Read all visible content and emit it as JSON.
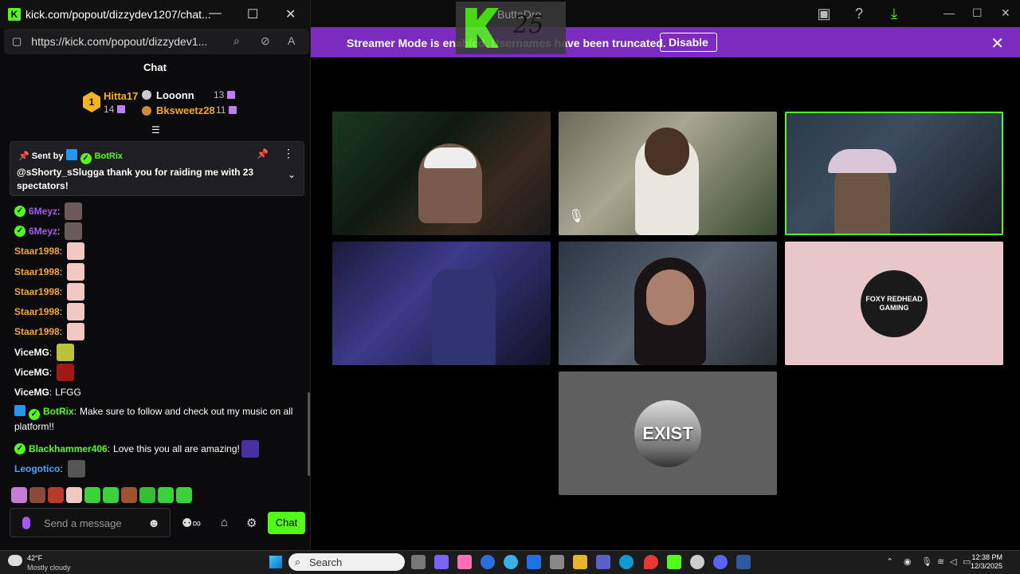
{
  "chat_window": {
    "title": "kick.com/popout/dizzydev1207/chat...",
    "url": "https://kick.com/popout/dizzydev1...",
    "header": "Chat"
  },
  "leaderboard": {
    "rank1_name": "Hitta17",
    "rank1_count": "14",
    "rank2_name": "Looonn",
    "rank2_count": "13",
    "rank3_name": "Bksweetz28",
    "rank3_count": "11"
  },
  "pinned": {
    "sent_by_label": "Sent by",
    "sender": "BotRix",
    "message": "@sShorty_sSlugga thank you for raiding me with 23 spectators!"
  },
  "messages": [
    {
      "user": "6Meyz",
      "color": "#a855f7",
      "text": ""
    },
    {
      "user": "6Meyz",
      "color": "#a855f7",
      "text": ""
    },
    {
      "user": "Staar1998",
      "color": "#f5a623",
      "text": ""
    },
    {
      "user": "Staar1998",
      "color": "#f5a623",
      "text": ""
    },
    {
      "user": "Staar1998",
      "color": "#f5a623",
      "text": ""
    },
    {
      "user": "Staar1998",
      "color": "#f5a623",
      "text": ""
    },
    {
      "user": "Staar1998",
      "color": "#f5a623",
      "text": ""
    },
    {
      "user": "ViceMG",
      "color": "#ffffff",
      "text": ""
    },
    {
      "user": "ViceMG",
      "color": "#ffffff",
      "text": ""
    },
    {
      "user": "ViceMG",
      "color": "#ffffff",
      "text": "LFGG"
    }
  ],
  "botrix_msg": {
    "user": "BotRix",
    "text": "Make sure to follow and check out my music on all platform!!"
  },
  "blackhammer_msg": {
    "user": "Blackhammer406",
    "text": "Love this you all are amazing!"
  },
  "leogotico_msg": {
    "user": "Leogotico"
  },
  "input": {
    "placeholder": "Send a message",
    "send_label": "Chat"
  },
  "banner": {
    "text": "Streamer Mode is enabled. Usernames have been truncated.",
    "button": "Disable"
  },
  "app_title_number": "25",
  "app_title_text": "ButtaDro",
  "tiles": [
    {
      "name": "tile-1",
      "bg": "#1d2a1d"
    },
    {
      "name": "tile-2",
      "bg": "#5a5a4a"
    },
    {
      "name": "tile-3",
      "bg": "#2a3442"
    },
    {
      "name": "tile-4",
      "bg": "#1e1e3a"
    },
    {
      "name": "tile-5",
      "bg": "#3b3f4a"
    },
    {
      "name": "tile-6",
      "bg": "#e7c7c9"
    },
    {
      "name": "tile-7",
      "bg": "#5f5f5f"
    }
  ],
  "foxy_logo": {
    "line1": "FOXY REDHEAD",
    "line2": "GAMING"
  },
  "exist_logo": "EXIST",
  "taskbar": {
    "temp": "42°F",
    "weather": "Mostly cloudy",
    "search": "Search",
    "time": "12:38 PM",
    "date": "12/3/2025"
  },
  "colors": {
    "kick_green": "#53fc18",
    "banner_purple": "#7b2cbf"
  }
}
